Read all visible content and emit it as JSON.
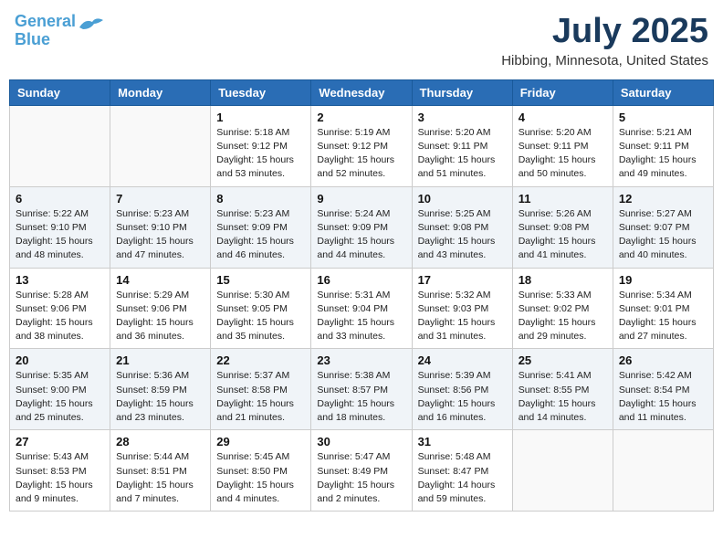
{
  "header": {
    "logo_line1": "General",
    "logo_line2": "Blue",
    "month": "July 2025",
    "location": "Hibbing, Minnesota, United States"
  },
  "weekdays": [
    "Sunday",
    "Monday",
    "Tuesday",
    "Wednesday",
    "Thursday",
    "Friday",
    "Saturday"
  ],
  "rows": [
    [
      {
        "num": "",
        "sunrise": "",
        "sunset": "",
        "daylight": ""
      },
      {
        "num": "",
        "sunrise": "",
        "sunset": "",
        "daylight": ""
      },
      {
        "num": "1",
        "sunrise": "Sunrise: 5:18 AM",
        "sunset": "Sunset: 9:12 PM",
        "daylight": "Daylight: 15 hours and 53 minutes."
      },
      {
        "num": "2",
        "sunrise": "Sunrise: 5:19 AM",
        "sunset": "Sunset: 9:12 PM",
        "daylight": "Daylight: 15 hours and 52 minutes."
      },
      {
        "num": "3",
        "sunrise": "Sunrise: 5:20 AM",
        "sunset": "Sunset: 9:11 PM",
        "daylight": "Daylight: 15 hours and 51 minutes."
      },
      {
        "num": "4",
        "sunrise": "Sunrise: 5:20 AM",
        "sunset": "Sunset: 9:11 PM",
        "daylight": "Daylight: 15 hours and 50 minutes."
      },
      {
        "num": "5",
        "sunrise": "Sunrise: 5:21 AM",
        "sunset": "Sunset: 9:11 PM",
        "daylight": "Daylight: 15 hours and 49 minutes."
      }
    ],
    [
      {
        "num": "6",
        "sunrise": "Sunrise: 5:22 AM",
        "sunset": "Sunset: 9:10 PM",
        "daylight": "Daylight: 15 hours and 48 minutes."
      },
      {
        "num": "7",
        "sunrise": "Sunrise: 5:23 AM",
        "sunset": "Sunset: 9:10 PM",
        "daylight": "Daylight: 15 hours and 47 minutes."
      },
      {
        "num": "8",
        "sunrise": "Sunrise: 5:23 AM",
        "sunset": "Sunset: 9:09 PM",
        "daylight": "Daylight: 15 hours and 46 minutes."
      },
      {
        "num": "9",
        "sunrise": "Sunrise: 5:24 AM",
        "sunset": "Sunset: 9:09 PM",
        "daylight": "Daylight: 15 hours and 44 minutes."
      },
      {
        "num": "10",
        "sunrise": "Sunrise: 5:25 AM",
        "sunset": "Sunset: 9:08 PM",
        "daylight": "Daylight: 15 hours and 43 minutes."
      },
      {
        "num": "11",
        "sunrise": "Sunrise: 5:26 AM",
        "sunset": "Sunset: 9:08 PM",
        "daylight": "Daylight: 15 hours and 41 minutes."
      },
      {
        "num": "12",
        "sunrise": "Sunrise: 5:27 AM",
        "sunset": "Sunset: 9:07 PM",
        "daylight": "Daylight: 15 hours and 40 minutes."
      }
    ],
    [
      {
        "num": "13",
        "sunrise": "Sunrise: 5:28 AM",
        "sunset": "Sunset: 9:06 PM",
        "daylight": "Daylight: 15 hours and 38 minutes."
      },
      {
        "num": "14",
        "sunrise": "Sunrise: 5:29 AM",
        "sunset": "Sunset: 9:06 PM",
        "daylight": "Daylight: 15 hours and 36 minutes."
      },
      {
        "num": "15",
        "sunrise": "Sunrise: 5:30 AM",
        "sunset": "Sunset: 9:05 PM",
        "daylight": "Daylight: 15 hours and 35 minutes."
      },
      {
        "num": "16",
        "sunrise": "Sunrise: 5:31 AM",
        "sunset": "Sunset: 9:04 PM",
        "daylight": "Daylight: 15 hours and 33 minutes."
      },
      {
        "num": "17",
        "sunrise": "Sunrise: 5:32 AM",
        "sunset": "Sunset: 9:03 PM",
        "daylight": "Daylight: 15 hours and 31 minutes."
      },
      {
        "num": "18",
        "sunrise": "Sunrise: 5:33 AM",
        "sunset": "Sunset: 9:02 PM",
        "daylight": "Daylight: 15 hours and 29 minutes."
      },
      {
        "num": "19",
        "sunrise": "Sunrise: 5:34 AM",
        "sunset": "Sunset: 9:01 PM",
        "daylight": "Daylight: 15 hours and 27 minutes."
      }
    ],
    [
      {
        "num": "20",
        "sunrise": "Sunrise: 5:35 AM",
        "sunset": "Sunset: 9:00 PM",
        "daylight": "Daylight: 15 hours and 25 minutes."
      },
      {
        "num": "21",
        "sunrise": "Sunrise: 5:36 AM",
        "sunset": "Sunset: 8:59 PM",
        "daylight": "Daylight: 15 hours and 23 minutes."
      },
      {
        "num": "22",
        "sunrise": "Sunrise: 5:37 AM",
        "sunset": "Sunset: 8:58 PM",
        "daylight": "Daylight: 15 hours and 21 minutes."
      },
      {
        "num": "23",
        "sunrise": "Sunrise: 5:38 AM",
        "sunset": "Sunset: 8:57 PM",
        "daylight": "Daylight: 15 hours and 18 minutes."
      },
      {
        "num": "24",
        "sunrise": "Sunrise: 5:39 AM",
        "sunset": "Sunset: 8:56 PM",
        "daylight": "Daylight: 15 hours and 16 minutes."
      },
      {
        "num": "25",
        "sunrise": "Sunrise: 5:41 AM",
        "sunset": "Sunset: 8:55 PM",
        "daylight": "Daylight: 15 hours and 14 minutes."
      },
      {
        "num": "26",
        "sunrise": "Sunrise: 5:42 AM",
        "sunset": "Sunset: 8:54 PM",
        "daylight": "Daylight: 15 hours and 11 minutes."
      }
    ],
    [
      {
        "num": "27",
        "sunrise": "Sunrise: 5:43 AM",
        "sunset": "Sunset: 8:53 PM",
        "daylight": "Daylight: 15 hours and 9 minutes."
      },
      {
        "num": "28",
        "sunrise": "Sunrise: 5:44 AM",
        "sunset": "Sunset: 8:51 PM",
        "daylight": "Daylight: 15 hours and 7 minutes."
      },
      {
        "num": "29",
        "sunrise": "Sunrise: 5:45 AM",
        "sunset": "Sunset: 8:50 PM",
        "daylight": "Daylight: 15 hours and 4 minutes."
      },
      {
        "num": "30",
        "sunrise": "Sunrise: 5:47 AM",
        "sunset": "Sunset: 8:49 PM",
        "daylight": "Daylight: 15 hours and 2 minutes."
      },
      {
        "num": "31",
        "sunrise": "Sunrise: 5:48 AM",
        "sunset": "Sunset: 8:47 PM",
        "daylight": "Daylight: 14 hours and 59 minutes."
      },
      {
        "num": "",
        "sunrise": "",
        "sunset": "",
        "daylight": ""
      },
      {
        "num": "",
        "sunrise": "",
        "sunset": "",
        "daylight": ""
      }
    ]
  ]
}
